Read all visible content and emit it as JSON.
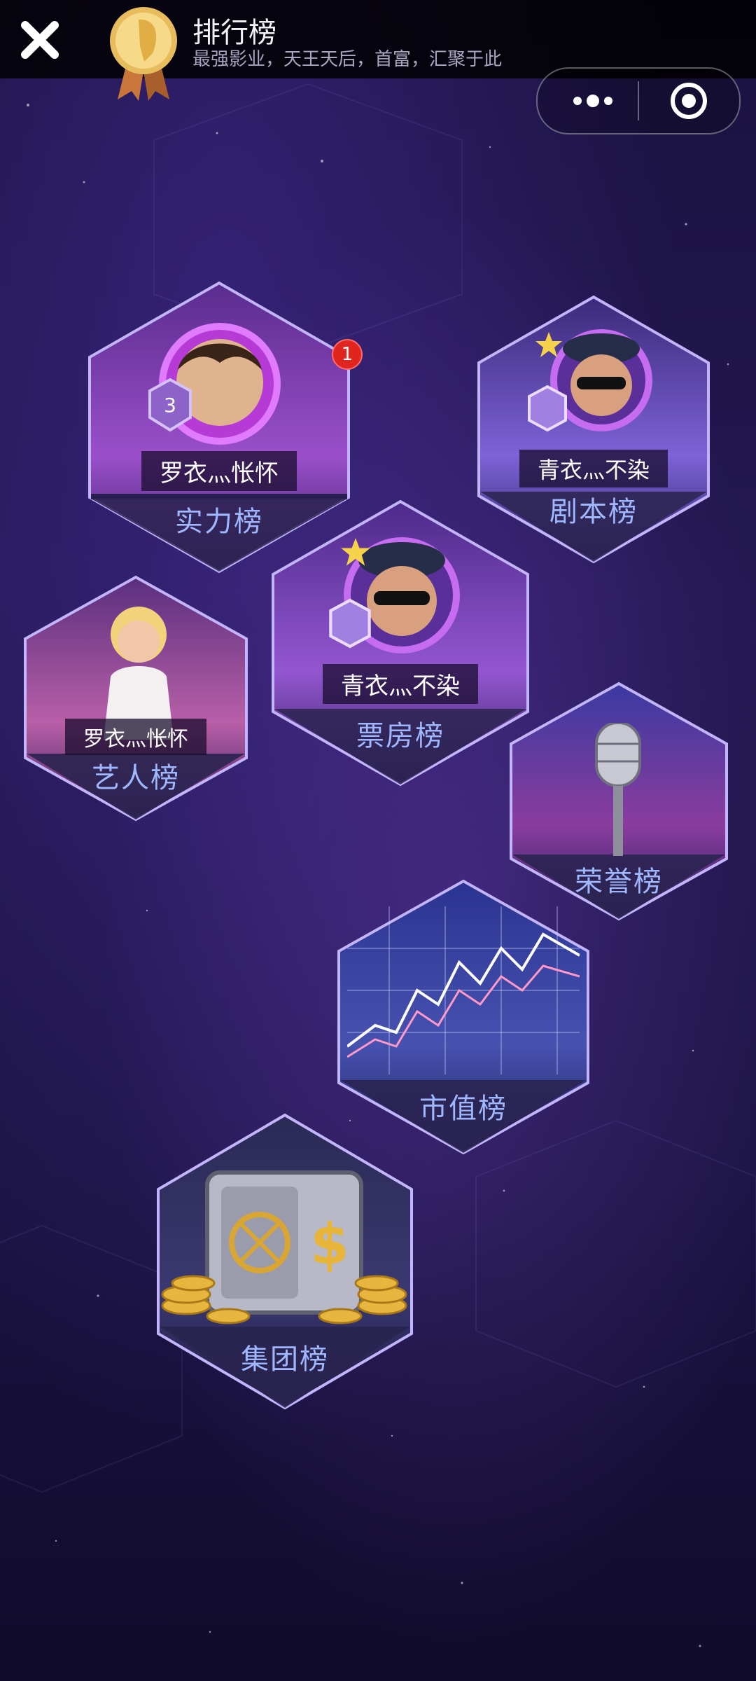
{
  "header": {
    "title": "排行榜",
    "subtitle": "最强影业，天王天后，首富，汇聚于此"
  },
  "boards": {
    "strength": {
      "label": "实力榜",
      "player": "罗衣灬怅怀",
      "notification_count": "1"
    },
    "script": {
      "label": "剧本榜",
      "player": "青衣灬不染"
    },
    "box_office": {
      "label": "票房榜",
      "player": "青衣灬不染"
    },
    "artist": {
      "label": "艺人榜",
      "player": "罗衣灬怅怀"
    },
    "honor": {
      "label": "荣誉榜"
    },
    "market_value": {
      "label": "市值榜"
    },
    "group": {
      "label": "集团榜"
    }
  },
  "rank_badge": {
    "strength_level": "3"
  },
  "icons": {
    "close": "close-icon",
    "medal": "medal-icon",
    "more": "more-icon",
    "miniprogram": "target-icon",
    "microphone": "microphone-icon",
    "stock_chart": "stock-chart-icon",
    "safe": "safe-icon"
  },
  "colors": {
    "label": "#9fb7ff",
    "hex_border": "#8b80d8",
    "badge": "#e0241e"
  }
}
